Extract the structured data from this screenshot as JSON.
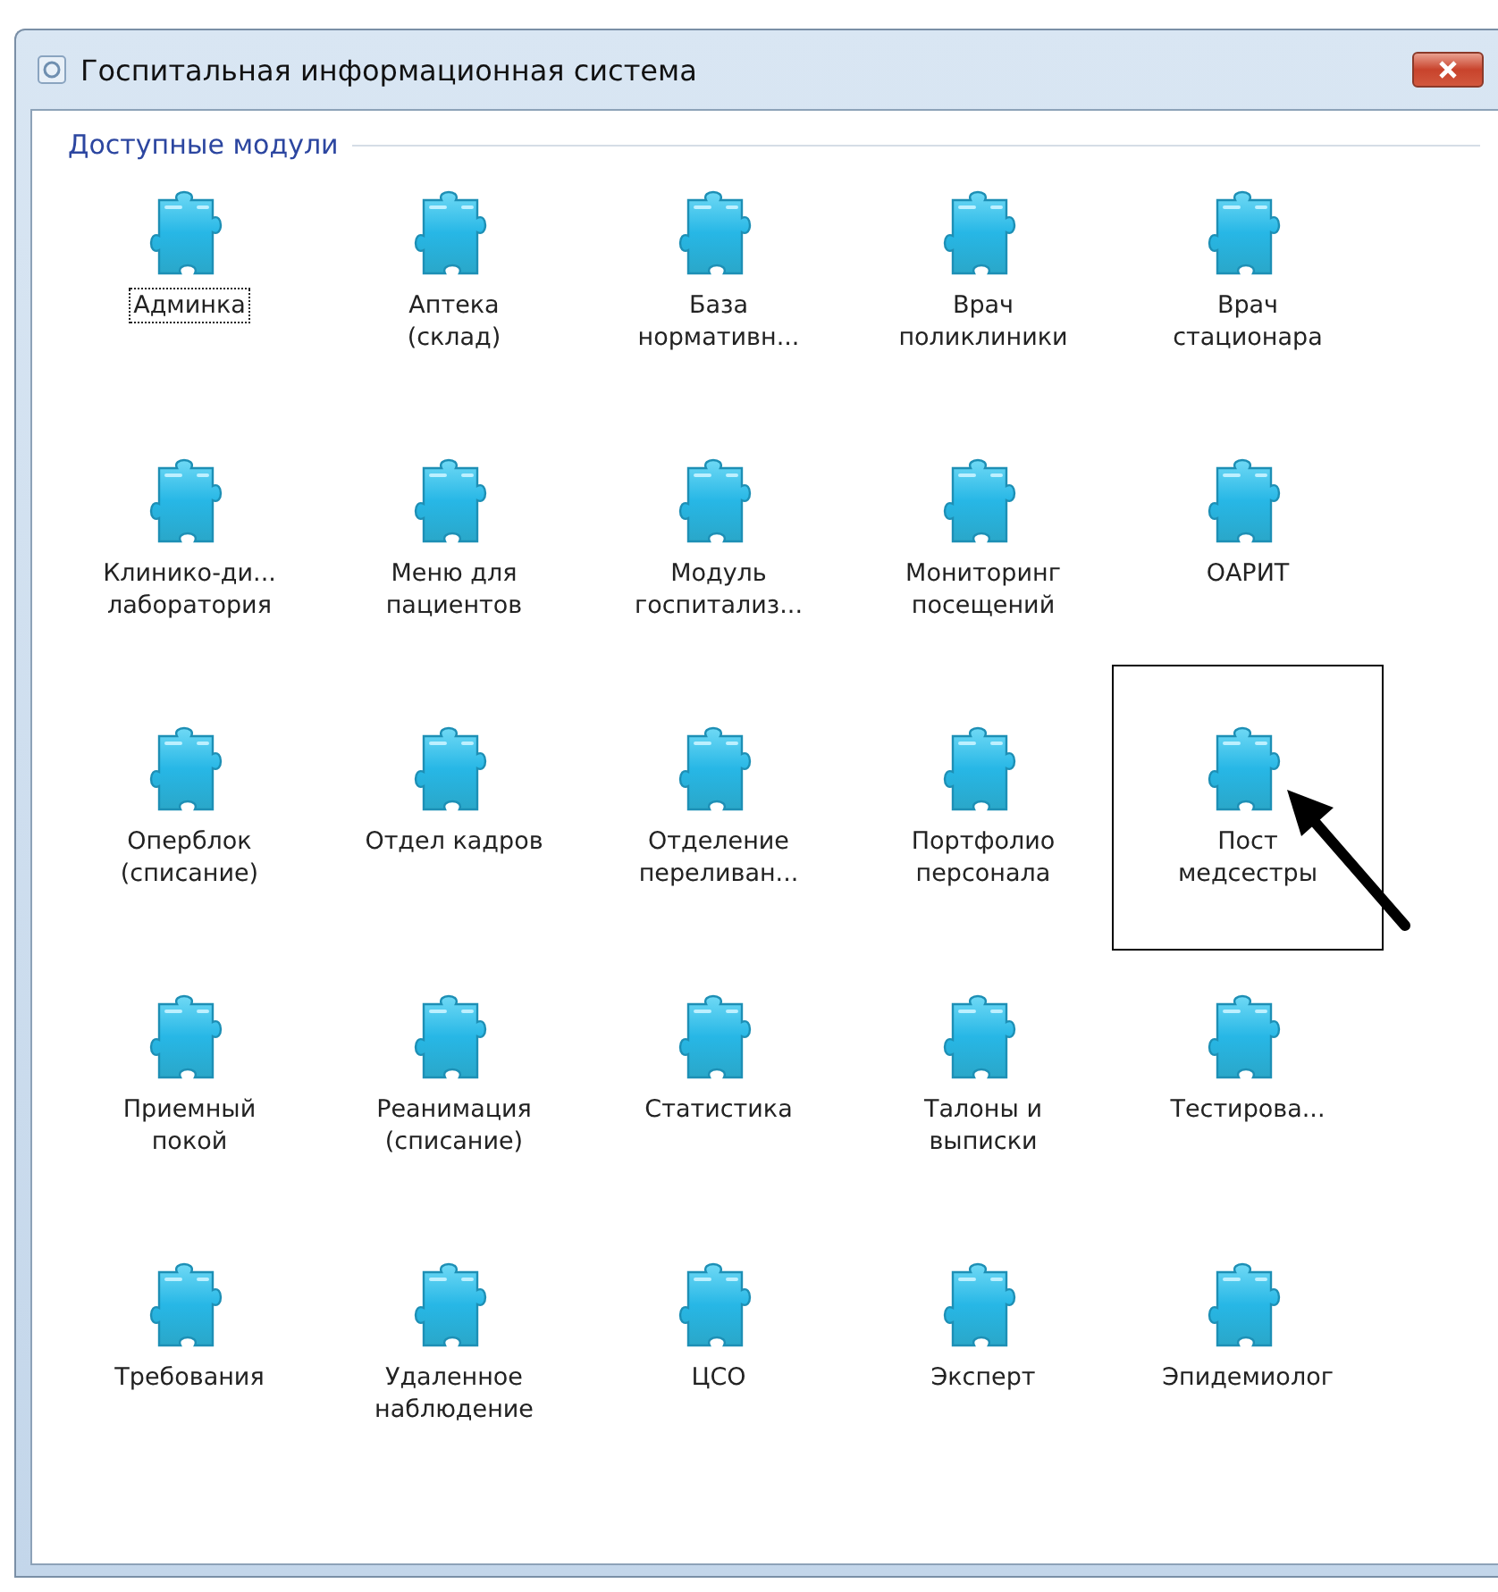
{
  "window": {
    "title": "Госпитальная информационная система"
  },
  "group": {
    "title": "Доступные модули"
  },
  "modules": [
    {
      "label": "Админка",
      "focused": true,
      "highlighted": false
    },
    {
      "label": "Аптека\n(склад)",
      "focused": false,
      "highlighted": false
    },
    {
      "label": "База\nнормативн...",
      "focused": false,
      "highlighted": false
    },
    {
      "label": "Врач\nполиклиники",
      "focused": false,
      "highlighted": false
    },
    {
      "label": "Врач\nстационара",
      "focused": false,
      "highlighted": false
    },
    {
      "label": "Клинико-ди...\nлаборатория",
      "focused": false,
      "highlighted": false
    },
    {
      "label": "Меню для\nпациентов",
      "focused": false,
      "highlighted": false
    },
    {
      "label": "Модуль\nгоспитализ...",
      "focused": false,
      "highlighted": false
    },
    {
      "label": "Мониторинг\nпосещений",
      "focused": false,
      "highlighted": false
    },
    {
      "label": "ОАРИТ",
      "focused": false,
      "highlighted": false
    },
    {
      "label": "Оперблок\n(списание)",
      "focused": false,
      "highlighted": false
    },
    {
      "label": "Отдел кадров",
      "focused": false,
      "highlighted": false
    },
    {
      "label": "Отделение\nпереливан...",
      "focused": false,
      "highlighted": false
    },
    {
      "label": "Портфолио\nперсонала",
      "focused": false,
      "highlighted": false
    },
    {
      "label": "Пост\nмедсестры",
      "focused": false,
      "highlighted": true
    },
    {
      "label": "Приемный\nпокой",
      "focused": false,
      "highlighted": false
    },
    {
      "label": "Реанимация\n(списание)",
      "focused": false,
      "highlighted": false
    },
    {
      "label": "Статистика",
      "focused": false,
      "highlighted": false
    },
    {
      "label": "Талоны и\nвыписки",
      "focused": false,
      "highlighted": false
    },
    {
      "label": "Тестирова...",
      "focused": false,
      "highlighted": false
    },
    {
      "label": "Требования",
      "focused": false,
      "highlighted": false
    },
    {
      "label": "Удаленное\nнаблюдение",
      "focused": false,
      "highlighted": false
    },
    {
      "label": "ЦСО",
      "focused": false,
      "highlighted": false
    },
    {
      "label": "Эксперт",
      "focused": false,
      "highlighted": false
    },
    {
      "label": "Эпидемиолог",
      "focused": false,
      "highlighted": false
    }
  ]
}
